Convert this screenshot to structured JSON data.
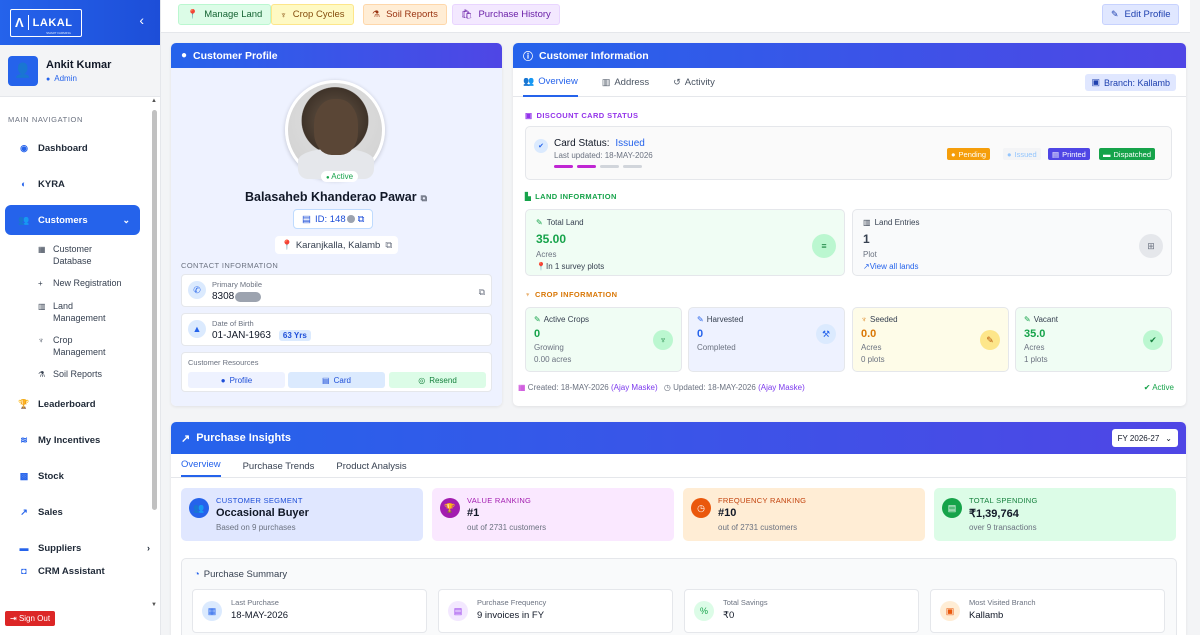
{
  "brand": {
    "logo_mark": "Λ",
    "name": "LAKAL",
    "tagline": "SMART FARMING"
  },
  "user": {
    "name": "Ankit Kumar",
    "role": "Admin"
  },
  "nav": {
    "heading": "MAIN NAVIGATION",
    "items": [
      {
        "label": "Dashboard",
        "icon": "dashboard-icon"
      },
      {
        "label": "KYRA",
        "icon": "brain-icon"
      },
      {
        "label": "Customers",
        "icon": "users-icon"
      },
      {
        "label": "Leaderboard",
        "icon": "trophy-icon"
      },
      {
        "label": "My Incentives",
        "icon": "coins-icon"
      },
      {
        "label": "Stock",
        "icon": "boxes-icon"
      },
      {
        "label": "Sales",
        "icon": "chart-line-icon"
      },
      {
        "label": "Suppliers",
        "icon": "truck-icon"
      },
      {
        "label": "CRM Assistant",
        "icon": "robot-icon"
      }
    ],
    "sub_items": [
      {
        "label": "Customer Database",
        "icon": "table-icon"
      },
      {
        "label": "New Registration",
        "icon": "user-plus-icon"
      },
      {
        "label": "Land Management",
        "icon": "map-icon"
      },
      {
        "label": "Crop Management",
        "icon": "seedling-icon"
      },
      {
        "label": "Soil Reports",
        "icon": "flask-icon"
      }
    ],
    "sign_out": "Sign Out"
  },
  "toolbar": {
    "manage_land": "Manage Land",
    "crop_cycles": "Crop Cycles",
    "soil_reports": "Soil Reports",
    "purchase_history": "Purchase History",
    "edit_profile": "Edit Profile"
  },
  "profile": {
    "title": "Customer Profile",
    "status": "Active",
    "name": "Balasaheb Khanderao Pawar",
    "id": "ID: 148",
    "location": "Karanjkalla, Kalamb",
    "contact_heading": "CONTACT INFORMATION",
    "mobile_label": "Primary Mobile",
    "mobile_value": "8308",
    "dob_label": "Date of Birth",
    "dob_value": "01-JAN-1963",
    "age": "63 Yrs",
    "resources_label": "Customer Resources",
    "btn_profile": "Profile",
    "btn_card": "Card",
    "btn_resend": "Resend"
  },
  "info": {
    "title": "Customer Information",
    "tabs": [
      "Overview",
      "Address",
      "Activity"
    ],
    "branch": "Branch: Kallamb",
    "discount_heading": "DISCOUNT CARD STATUS",
    "card_status_label": "Card Status:",
    "card_status_value": "Issued",
    "card_updated": "Last updated: 18-MAY-2026",
    "status_tags": [
      "Pending",
      "Issued",
      "Printed",
      "Dispatched"
    ],
    "land_heading": "LAND INFORMATION",
    "total_land_label": "Total Land",
    "total_land_value": "35.00",
    "total_land_unit": "Acres",
    "total_land_note": "In 1 survey plots",
    "land_entries_label": "Land Entries",
    "land_entries_value": "1",
    "land_entries_unit": "Plot",
    "land_entries_link": "View all lands",
    "crop_heading": "CROP INFORMATION",
    "crops": [
      {
        "label": "Active Crops",
        "value": "0",
        "sub1": "Growing",
        "sub2": "0.00 acres"
      },
      {
        "label": "Harvested",
        "value": "0",
        "sub1": "Completed",
        "sub2": ""
      },
      {
        "label": "Seeded",
        "value": "0.0",
        "sub1": "Acres",
        "sub2": "0 plots"
      },
      {
        "label": "Vacant",
        "value": "35.0",
        "sub1": "Acres",
        "sub2": "1 plots"
      }
    ],
    "created": "Created: 18-MAY-2026",
    "created_by": "(Ajay Maske)",
    "updated": "Updated: 18-MAY-2026",
    "updated_by": "(Ajay Maske)",
    "active": "Active"
  },
  "insights": {
    "title": "Purchase Insights",
    "fy": "FY 2026-27",
    "tabs": [
      "Overview",
      "Purchase Trends",
      "Product Analysis"
    ],
    "cards": [
      {
        "label": "CUSTOMER SEGMENT",
        "value": "Occasional Buyer",
        "sub": "Based on 9 purchases"
      },
      {
        "label": "VALUE RANKING",
        "value": "#1",
        "sub": "out of 2731 customers"
      },
      {
        "label": "FREQUENCY RANKING",
        "value": "#10",
        "sub": "out of 2731 customers"
      },
      {
        "label": "TOTAL SPENDING",
        "value": "₹1,39,764",
        "sub": "over 9 transactions"
      }
    ],
    "summary_title": "Purchase Summary",
    "summary": [
      {
        "label": "Last Purchase",
        "value": "18-MAY-2026"
      },
      {
        "label": "Purchase Frequency",
        "value": "9 invoices in FY"
      },
      {
        "label": "Total Savings",
        "value": "₹0"
      },
      {
        "label": "Most Visited Branch",
        "value": "Kallamb"
      }
    ]
  }
}
